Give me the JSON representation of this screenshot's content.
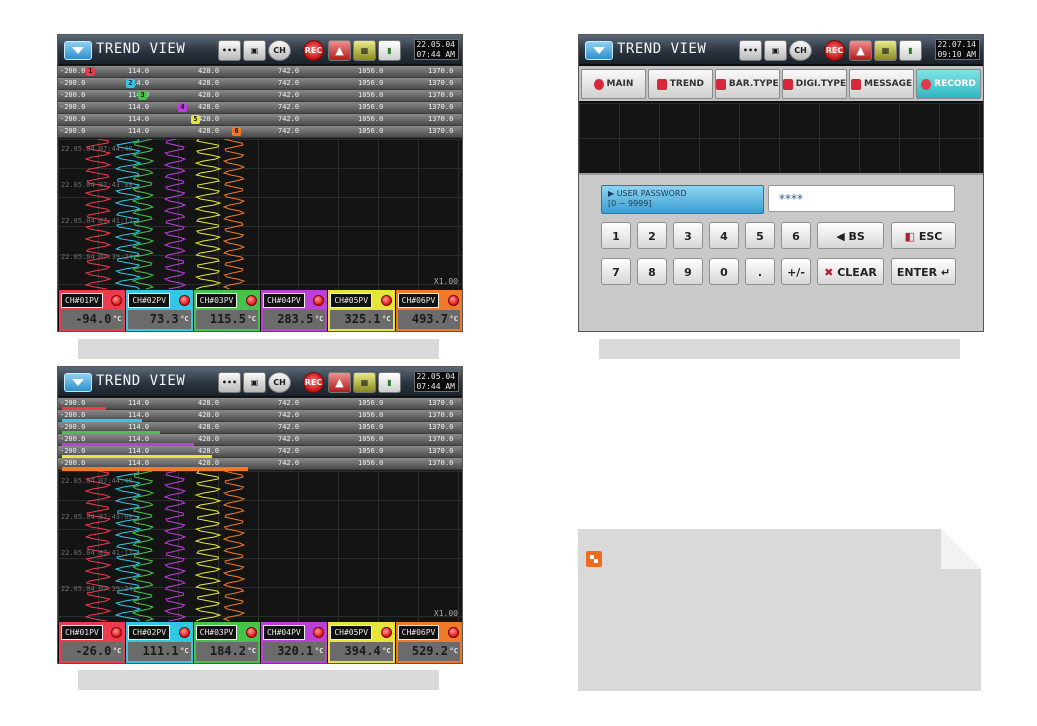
{
  "trend_screen_1": {
    "title": "TREND VIEW",
    "date": "22.05.04",
    "time": "07:44 AM",
    "toolbar": {
      "more": "•••",
      "rec": "REC",
      "ch": "CH"
    },
    "scales": [
      [
        "-200.0",
        "114.0",
        "428.0",
        "742.0",
        "1056.0",
        "1370.0"
      ],
      [
        "-200.0",
        "114.0",
        "428.0",
        "742.0",
        "1056.0",
        "1370.0"
      ],
      [
        "-200.0",
        "114.0",
        "428.0",
        "742.0",
        "1056.0",
        "1370.0"
      ],
      [
        "-200.0",
        "114.0",
        "428.0",
        "742.0",
        "1056.0",
        "1370.0"
      ],
      [
        "-200.0",
        "114.0",
        "428.0",
        "742.0",
        "1056.0",
        "1370.0"
      ],
      [
        "-200.0",
        "114.0",
        "428.0",
        "742.0",
        "1056.0",
        "1370.0"
      ]
    ],
    "markers": [
      "1",
      "2",
      "3",
      "4",
      "5",
      "6"
    ],
    "time_labels": [
      "22.05.04 07:44:48",
      "22.05.04 07:43:00",
      "22.05.04 07:41:12",
      "22.05.04 07:39:24"
    ],
    "zoom": "X1.00",
    "channels": [
      {
        "name": "CH#01PV",
        "value": "-94.0",
        "unit": "°C"
      },
      {
        "name": "CH#02PV",
        "value": "73.3",
        "unit": "°C"
      },
      {
        "name": "CH#03PV",
        "value": "115.5",
        "unit": "°C"
      },
      {
        "name": "CH#04PV",
        "value": "283.5",
        "unit": "°C"
      },
      {
        "name": "CH#05PV",
        "value": "325.1",
        "unit": "°C"
      },
      {
        "name": "CH#06PV",
        "value": "493.7",
        "unit": "°C"
      }
    ]
  },
  "trend_screen_2": {
    "title": "TREND VIEW",
    "date": "22.05.04",
    "time": "07:44 AM",
    "toolbar": {
      "more": "•••",
      "rec": "REC",
      "ch": "CH"
    },
    "scales": [
      [
        "-200.0",
        "114.0",
        "428.0",
        "742.0",
        "1056.0",
        "1370.0"
      ],
      [
        "-200.0",
        "114.0",
        "428.0",
        "742.0",
        "1056.0",
        "1370.0"
      ],
      [
        "-200.0",
        "114.0",
        "428.0",
        "742.0",
        "1056.0",
        "1370.0"
      ],
      [
        "-200.0",
        "114.0",
        "428.0",
        "742.0",
        "1056.0",
        "1370.0"
      ],
      [
        "-200.0",
        "114.0",
        "428.0",
        "742.0",
        "1056.0",
        "1370.0"
      ],
      [
        "-200.0",
        "114.0",
        "428.0",
        "742.0",
        "1056.0",
        "1370.0"
      ]
    ],
    "time_labels": [
      "22.05.04 07:44:48",
      "22.05.04 07:43:00",
      "22.05.04 07:41:12",
      "22.05.04 07:39:24"
    ],
    "zoom": "X1.00",
    "channels": [
      {
        "name": "CH#01PV",
        "value": "-26.0",
        "unit": "°C"
      },
      {
        "name": "CH#02PV",
        "value": "111.1",
        "unit": "°C"
      },
      {
        "name": "CH#03PV",
        "value": "184.2",
        "unit": "°C"
      },
      {
        "name": "CH#04PV",
        "value": "320.1",
        "unit": "°C"
      },
      {
        "name": "CH#05PV",
        "value": "394.4",
        "unit": "°C"
      },
      {
        "name": "CH#06PV",
        "value": "529.2",
        "unit": "°C"
      }
    ]
  },
  "record_screen": {
    "title": "TREND VIEW",
    "date": "22.07.14",
    "time": "09:10 AM",
    "toolbar": {
      "more": "•••",
      "rec": "REC",
      "ch": "CH"
    },
    "tabs": [
      "MAIN",
      "TREND",
      "BAR.TYPE",
      "DIGI.TYPE",
      "MESSAGE",
      "RECORD"
    ],
    "password_label": "▶ USER PASSWORD",
    "password_range": "[0 ~ 9999]",
    "password_value": "****",
    "keys_row1": [
      "1",
      "2",
      "3",
      "4",
      "5",
      "6"
    ],
    "keys_row2": [
      "7",
      "8",
      "9",
      "0",
      ".",
      "+/-"
    ],
    "key_bs": "BS",
    "key_esc": "ESC",
    "key_clear": "CLEAR",
    "key_enter": "ENTER"
  },
  "colors": {
    "ch1": "#ee3a4f",
    "ch2": "#33c7e6",
    "ch3": "#47c24a",
    "ch4": "#bc3fd8",
    "ch5": "#e6e63a",
    "ch6": "#f07a28",
    "note_icon": "#ef6a1c"
  }
}
